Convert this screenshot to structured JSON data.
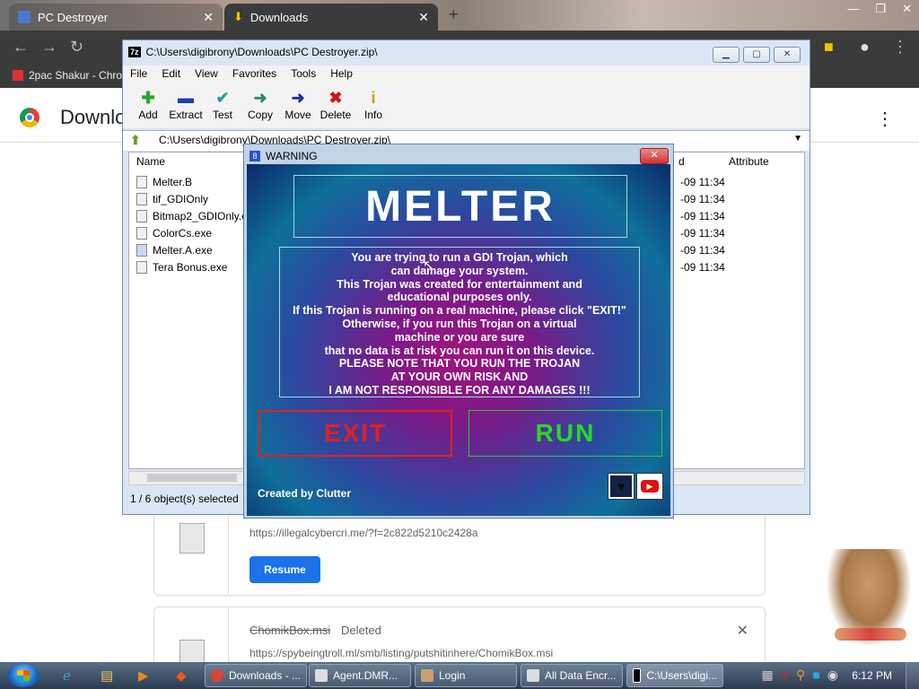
{
  "browser": {
    "tabs": [
      {
        "title": "PC Destroyer",
        "close": "✕"
      },
      {
        "title": "Downloads",
        "close": "✕"
      }
    ],
    "new_tab": "+",
    "window_controls": [
      "—",
      "❐",
      "✕"
    ],
    "bookmark": "2pac Shakur - Chro",
    "page_title": "Downloads",
    "menu": "⋮"
  },
  "downloads": [
    {
      "url": "https://illegalcybercri.me/?f=2c822d5210c2428a",
      "button": "Resume"
    },
    {
      "name": "ChomikBox.msi",
      "status": "Deleted",
      "url": "https://spybeingtroll.ml/smb/listing/putshitinhere/ChomikBox.msi",
      "close": "✕"
    }
  ],
  "sevenzip": {
    "title": "C:\\Users\\digibrony\\Downloads\\PC Destroyer.zip\\",
    "logo": "7z",
    "menu": [
      "File",
      "Edit",
      "View",
      "Favorites",
      "Tools",
      "Help"
    ],
    "toolbar": [
      {
        "label": "Add",
        "icon": "plus-icon",
        "glyph": "✚",
        "color": "#2aa52a"
      },
      {
        "label": "Extract",
        "icon": "minus-icon",
        "glyph": "▬",
        "color": "#1c3fb0"
      },
      {
        "label": "Test",
        "icon": "check-icon",
        "glyph": "✔",
        "color": "#1aa7a0"
      },
      {
        "label": "Copy",
        "icon": "copy-arrow-icon",
        "glyph": "➜",
        "color": "#2a8a6a"
      },
      {
        "label": "Move",
        "icon": "move-arrow-icon",
        "glyph": "➜",
        "color": "#1c2f9a"
      },
      {
        "label": "Delete",
        "icon": "delete-x-icon",
        "glyph": "✖",
        "color": "#d01818"
      },
      {
        "label": "Info",
        "icon": "info-icon",
        "glyph": "i",
        "color": "#c9a000"
      }
    ],
    "address": "C:\\Users\\digibrony\\Downloads\\PC Destroyer.zip\\",
    "columns": [
      "Name",
      "d",
      "Attribute"
    ],
    "files": [
      {
        "name": "Melter.B",
        "date": "-09 11:34"
      },
      {
        "name": "tif_GDIOnly",
        "date": "-09 11:34"
      },
      {
        "name": "Bitmap2_GDIOnly.ex",
        "date": "-09 11:34"
      },
      {
        "name": "ColorCs.exe",
        "date": "-09 11:34"
      },
      {
        "name": "Melter.A.exe",
        "date": "-09 11:34"
      },
      {
        "name": "Tera Bonus.exe",
        "date": "-09 11:34"
      }
    ],
    "status": "1 / 6 object(s) selected"
  },
  "warning": {
    "title": "WARNING",
    "close": "✕",
    "heading": "MELTER",
    "message_lines": [
      "You are trying to run a GDI Trojan, which",
      "can damage your system.",
      "This Trojan was created for entertainment and",
      "educational purposes only.",
      "If this Trojan is running on a real machine, please click \"EXIT!\"",
      "Otherwise, if you run this Trojan on a virtual",
      "machine or you are sure",
      "that no data is at risk you can run it on this device.",
      "PLEASE NOTE THAT YOU RUN THE TROJAN",
      "AT YOUR OWN RISK AND",
      "I AM NOT RESPONSIBLE FOR ANY DAMAGES !!!"
    ],
    "exit_label": "EXIT",
    "run_label": "RUN",
    "credit": "Created by Clutter",
    "colors": {
      "exit": "#e02020",
      "run": "#22dd22"
    }
  },
  "taskbar": {
    "items": [
      {
        "label": "Downloads - ...",
        "icon": "chrome-icon",
        "color": "#db4437"
      },
      {
        "label": "Agent.DMR...",
        "icon": "window-icon",
        "color": "#dddddd"
      },
      {
        "label": "Login",
        "icon": "login-icon",
        "color": "#c9a070"
      },
      {
        "label": "All Data Encr...",
        "icon": "window-icon",
        "color": "#dddddd"
      },
      {
        "label": "C:\\Users\\digi...",
        "icon": "sevenzip-icon",
        "color": "#000000"
      }
    ],
    "clock": "6:12 PM"
  }
}
